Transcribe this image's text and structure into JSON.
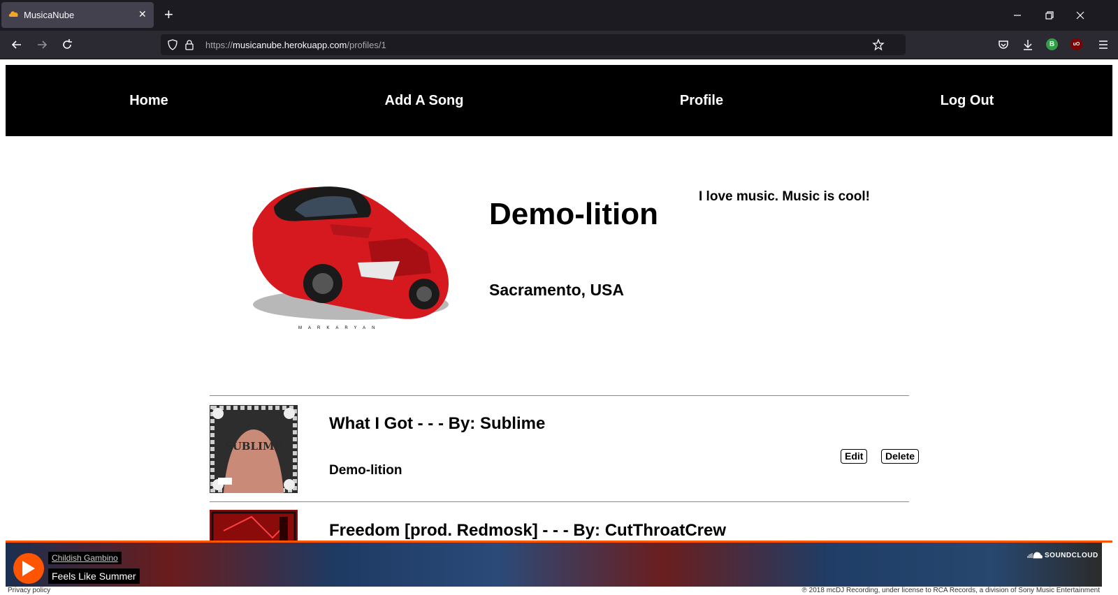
{
  "browser": {
    "tab_title": "MusicaNube",
    "url_scheme": "https://",
    "url_host": "musicanube.herokuapp.com",
    "url_path": "/profiles/1",
    "ext_b_label": "B",
    "ext_u_label": "uO"
  },
  "site_nav": {
    "home": "Home",
    "add_song": "Add A Song",
    "profile": "Profile",
    "logout": "Log Out"
  },
  "profile": {
    "name": "Demo-lition",
    "location": "Sacramento, USA",
    "bio": "I love music. Music is cool!"
  },
  "songs": [
    {
      "title": "What I Got - - - By: Sublime",
      "user": "Demo-lition",
      "edit_label": "Edit",
      "delete_label": "Delete"
    },
    {
      "title": "Freedom [prod. Redmosk] - - - By: CutThroatCrew"
    }
  ],
  "player": {
    "artist": "Childish Gambino",
    "track": "Feels Like Summer",
    "brand": "SOUNDCLOUD",
    "privacy": "Privacy policy",
    "copyright": "℗ 2018 mcDJ Recording, under license to RCA Records, a division of Sony Music Entertainment"
  },
  "colors": {
    "accent": "#ff5500",
    "nav_bg": "#000000"
  }
}
